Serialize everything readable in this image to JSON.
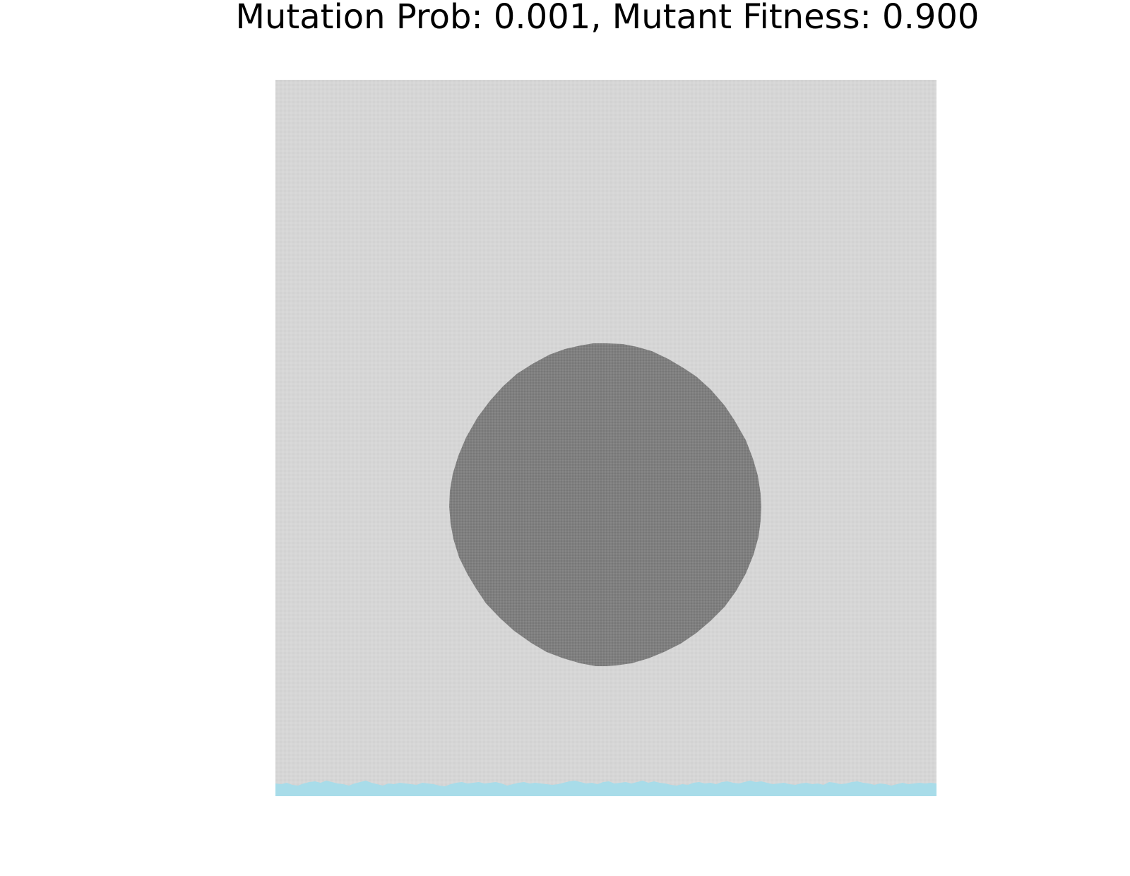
{
  "figure": {
    "title": "Mutation Prob: 0.001, Mutant Fitness: 0.900"
  },
  "lattice": {
    "cells": {
      "wild_type_color": "#d6d6d6",
      "mutant_color": "#7e7e7e",
      "empty_color": "#a8dce9"
    },
    "mutant_region": "circle",
    "colonized_front": "bottom edge, irregular"
  }
}
